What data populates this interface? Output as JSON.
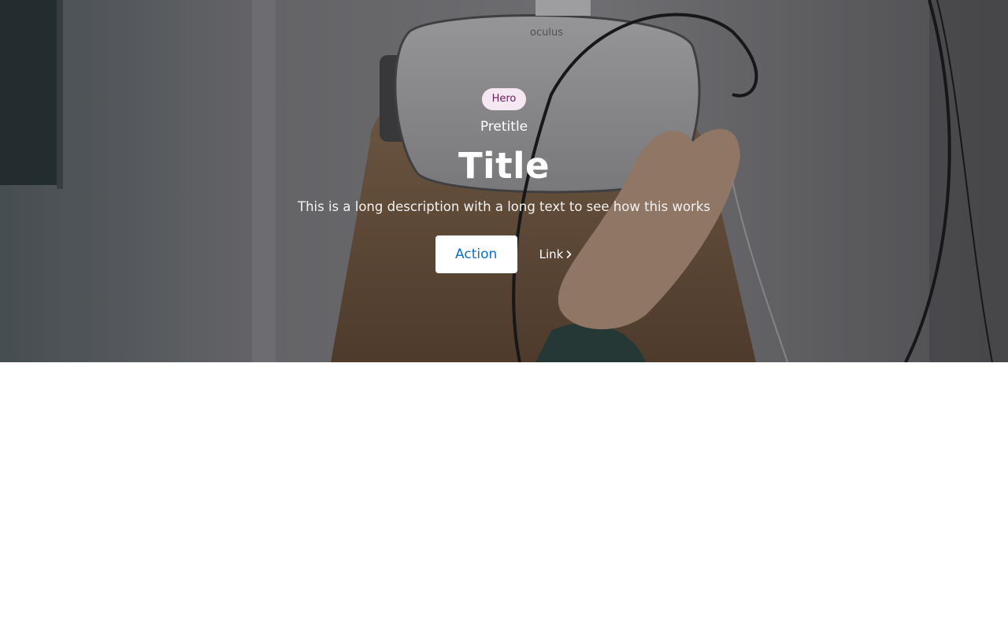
{
  "hero": {
    "badge": "Hero",
    "pretitle": "Pretitle",
    "title": "Title",
    "description": "This is a long description with a long text to see how this works",
    "action_label": "Action",
    "link_label": "Link",
    "link_icon": "chevron-right-icon",
    "image_brand_text": "oculus"
  },
  "colors": {
    "badge_bg": "#f6e8f3",
    "badge_text": "#6b1e5c",
    "action_text": "#0b6fc6",
    "lower_bg": "#ffffff"
  }
}
